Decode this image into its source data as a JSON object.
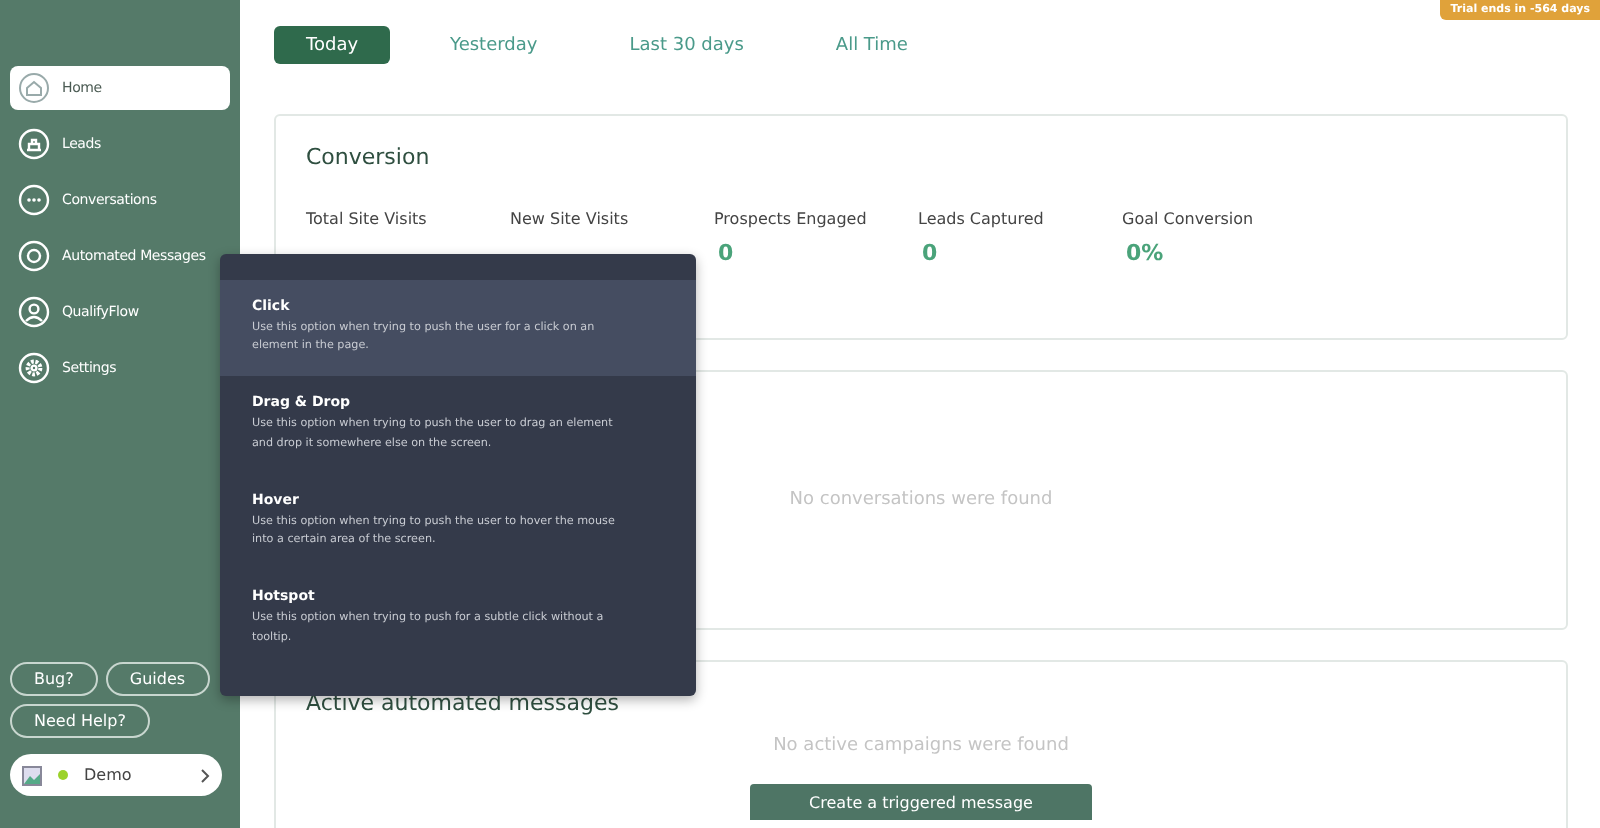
{
  "sidebar": {
    "items": [
      {
        "label": "Home",
        "selected": true
      },
      {
        "label": "Leads",
        "selected": false
      },
      {
        "label": "Conversations",
        "selected": false
      },
      {
        "label": "Automated Messages",
        "selected": false
      },
      {
        "label": "QualifyFlow",
        "selected": false
      },
      {
        "label": "Settings",
        "selected": false
      }
    ],
    "help_buttons": [
      "Bug?",
      "Guides",
      "Need Help?"
    ],
    "account": {
      "name": "Demo"
    }
  },
  "trial_badge": "Trial ends in -564 days",
  "tabs": [
    {
      "label": "Today",
      "selected": true
    },
    {
      "label": "Yesterday",
      "selected": false
    },
    {
      "label": "Last 30 days",
      "selected": false
    },
    {
      "label": "All Time",
      "selected": false
    }
  ],
  "conversion": {
    "title": "Conversion",
    "stats": [
      {
        "label": "Total Site Visits"
      },
      {
        "label": "New Site Visits"
      },
      {
        "label": "Prospects Engaged",
        "value": "0"
      },
      {
        "label": "Leads Captured",
        "value": "0"
      },
      {
        "label": "Goal Conversion",
        "value": "0%"
      }
    ]
  },
  "conversations": {
    "empty": "No conversations were found"
  },
  "automated": {
    "title": "Active automated messages",
    "empty": "No active campaigns were found",
    "button": "Create a triggered message"
  },
  "trigger_menu": {
    "options": [
      {
        "title": "Click",
        "description": "Use this option when trying to push the user for a click on an element in the page.",
        "selected": true
      },
      {
        "title": "Drag & Drop",
        "description": "Use this option when trying to push the user to drag an element and drop it somewhere else on the screen.",
        "selected": false
      },
      {
        "title": "Hover",
        "description": "Use this option when trying to push the user to hover the mouse into a certain area of the screen.",
        "selected": false
      },
      {
        "title": "Hotspot",
        "description": "Use this option when trying to push for a subtle click without a tooltip.",
        "selected": false
      }
    ]
  }
}
